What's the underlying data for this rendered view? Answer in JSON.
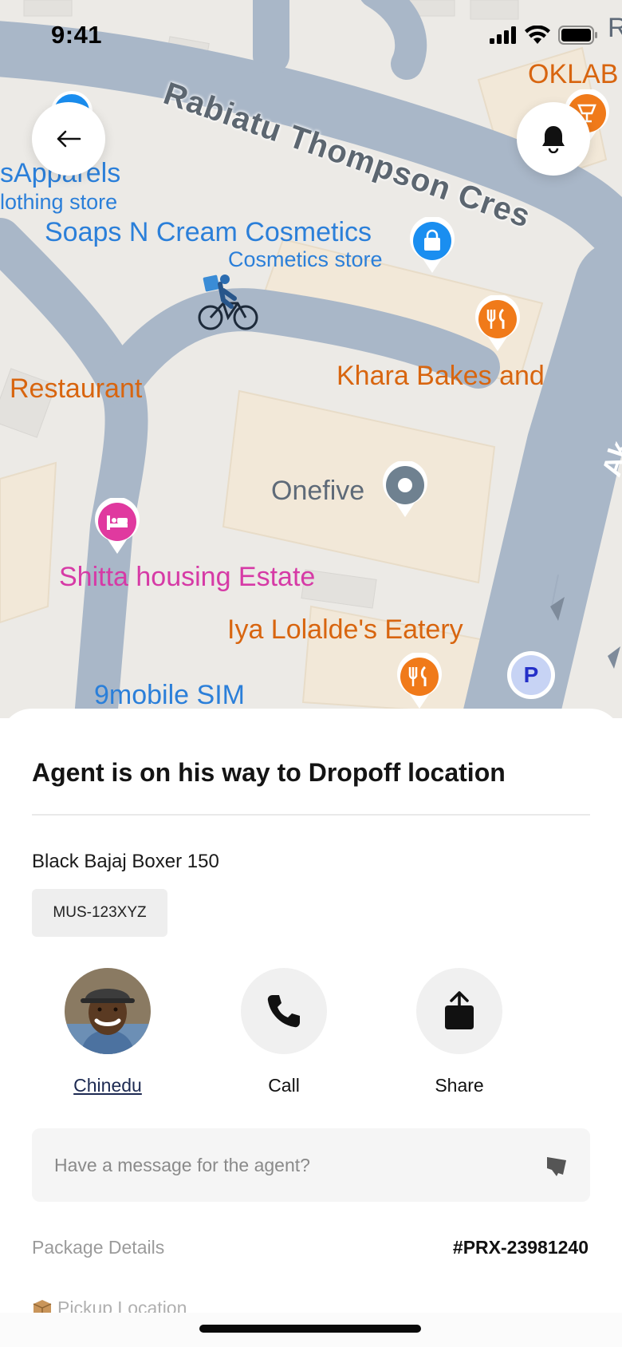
{
  "status_bar": {
    "time": "9:41"
  },
  "map": {
    "labels": {
      "street": "Rabiatu Thompson Cres",
      "apparels_name": "sApparels",
      "apparels_type": "lothing store",
      "cosmetics_name": "Soaps N Cream Cosmetics",
      "cosmetics_type": "Cosmetics store",
      "restaurant_left": "Restaurant",
      "khara": "Khara Bakes and",
      "onefive": "Onefive",
      "shitta": "Shitta housing Estate",
      "iya": "Iya Lolalde's Eatery",
      "ninemobile": "9mobile SIM",
      "oklab": "OKLAB",
      "top_right": "R",
      "right_road": "Ak"
    },
    "parking_letter": "P"
  },
  "icons": {
    "back": "arrow-left-icon",
    "notify": "bell-icon",
    "call": "phone-icon",
    "share": "share-icon",
    "send": "send-icon",
    "package": "package-icon"
  },
  "sheet": {
    "title": "Agent is on his way to Dropoff location",
    "vehicle": "Black Bajaj Boxer 150",
    "plate": "MUS-123XYZ",
    "actions": {
      "agent_name": "Chinedu",
      "call_label": "Call",
      "share_label": "Share"
    },
    "message": {
      "placeholder": "Have a message for the agent?",
      "value": ""
    },
    "package": {
      "label": "Package Details",
      "id": "#PRX-23981240",
      "pickup_label": "Pickup Location"
    }
  }
}
